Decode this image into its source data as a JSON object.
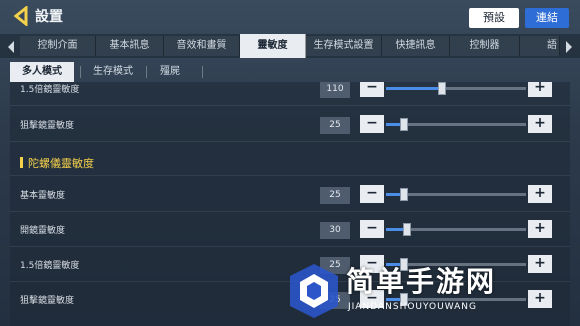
{
  "header": {
    "title": "設置",
    "preset_label": "預設",
    "link_label": "連結"
  },
  "tabs": [
    {
      "label": "控制介面"
    },
    {
      "label": "基本訊息"
    },
    {
      "label": "音效和畫質"
    },
    {
      "label": "靈敏度",
      "active": true
    },
    {
      "label": "生存模式設置"
    },
    {
      "label": "快捷訊息"
    },
    {
      "label": "控制器"
    },
    {
      "label": "語"
    }
  ],
  "subtabs": [
    {
      "label": "多人模式",
      "active": true
    },
    {
      "label": "生存模式"
    },
    {
      "label": "殭屍"
    }
  ],
  "scope_rows": [
    {
      "label": "1.5倍鏡靈敏度",
      "value": "110",
      "fraction": 0.4
    },
    {
      "label": "狙擊鏡靈敏度",
      "value": "25",
      "fraction": 0.13
    }
  ],
  "gyro_section": {
    "title": "陀螺儀靈敏度",
    "rows": [
      {
        "label": "基本靈敏度",
        "value": "25",
        "fraction": 0.13
      },
      {
        "label": "開鏡靈敏度",
        "value": "30",
        "fraction": 0.15
      },
      {
        "label": "1.5倍鏡靈敏度",
        "value": "25",
        "fraction": 0.13
      },
      {
        "label": "狙擊鏡靈敏度",
        "value": "25",
        "fraction": 0.13
      }
    ]
  },
  "watermark": {
    "text": "简单手游网",
    "sub": "JIANDANSHOUYOUWANG"
  },
  "colors": {
    "accent_yellow": "#f4d14a",
    "accent_blue": "#2f6dd6",
    "slider_fill": "#4a8ee8"
  }
}
